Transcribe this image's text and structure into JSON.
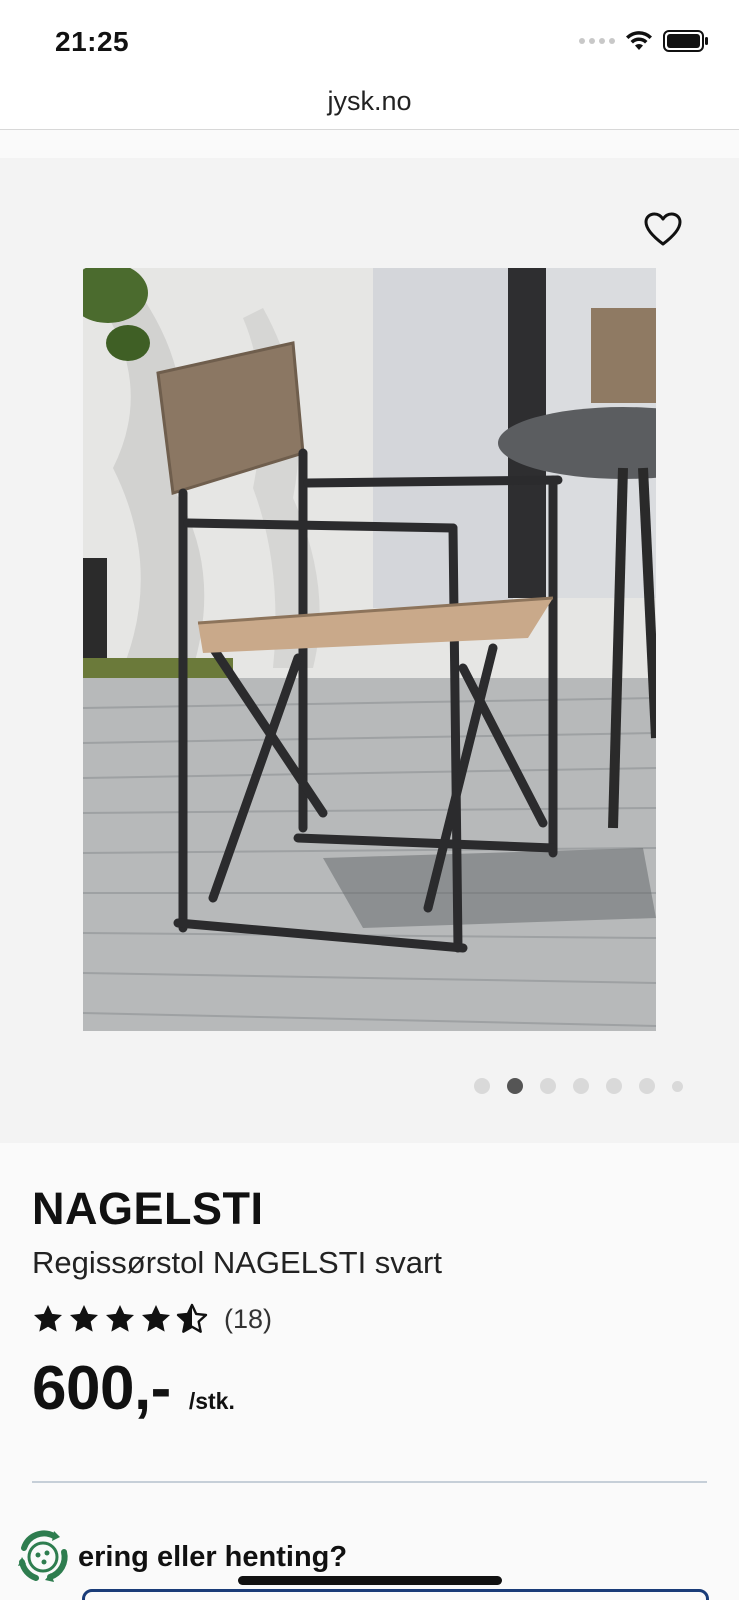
{
  "status_bar": {
    "time": "21:25"
  },
  "browser": {
    "url": "jysk.no"
  },
  "gallery": {
    "image_count": 7,
    "active_index": 1
  },
  "product": {
    "brand": "NAGELSTI",
    "name": "Regissørstol NAGELSTI svart",
    "rating_value": 4.5,
    "rating_max": 5,
    "review_count": "(18)",
    "price": "600,-",
    "price_unit": "/stk."
  },
  "delivery": {
    "question": "ering eller henting?"
  },
  "colors": {
    "accent_blue": "#1a3c78",
    "gallery_bg": "#f3f3f3",
    "icon_green": "#2e7d4f"
  }
}
